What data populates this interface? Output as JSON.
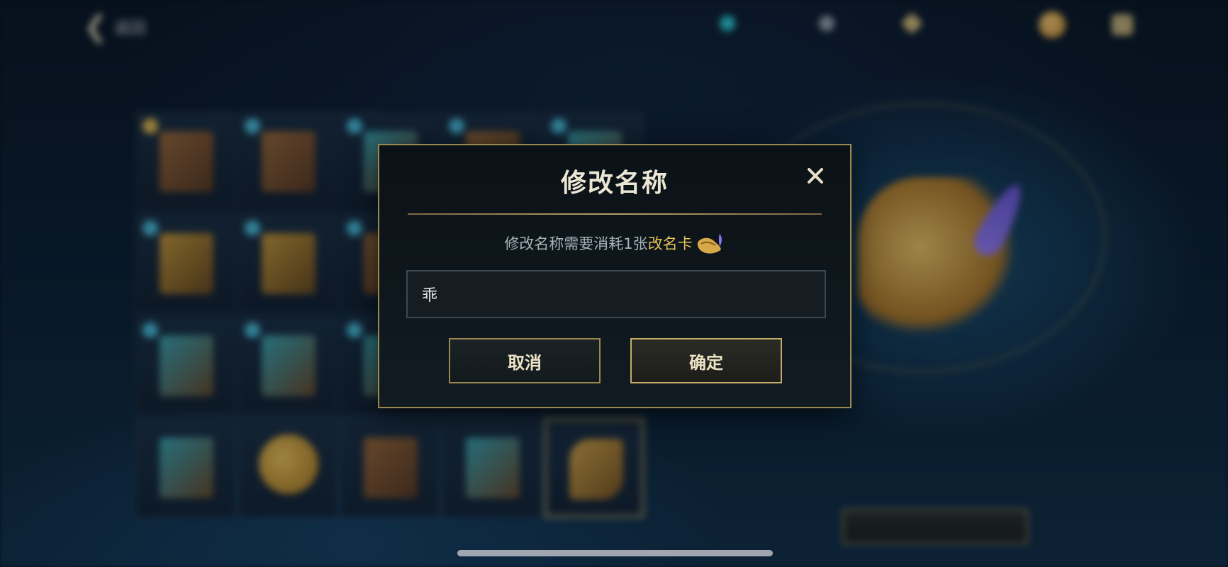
{
  "background": {
    "back_label": "返回",
    "resources": [
      "",
      "",
      ""
    ],
    "tabs": [
      "",
      "",
      "",
      "",
      "",
      ""
    ],
    "grid_counts": [
      "",
      "",
      "",
      "",
      "",
      "",
      "",
      "",
      "",
      "",
      "",
      "",
      "",
      "",
      "",
      "",
      "",
      "",
      "",
      ""
    ],
    "preview_name": "",
    "preview_desc": "",
    "use_button_label": ""
  },
  "modal": {
    "title": "修改名称",
    "message_prefix": "修改名称需要消耗1张",
    "message_highlight": "改名卡",
    "input_value": "乖",
    "cancel_label": "取消",
    "confirm_label": "确定",
    "close_icon": "close-icon",
    "card_icon": "rename-card-icon"
  },
  "colors": {
    "accent_gold": "#e6c25a",
    "border_gold": "#9b8752",
    "modal_bg": "#0b1217"
  }
}
